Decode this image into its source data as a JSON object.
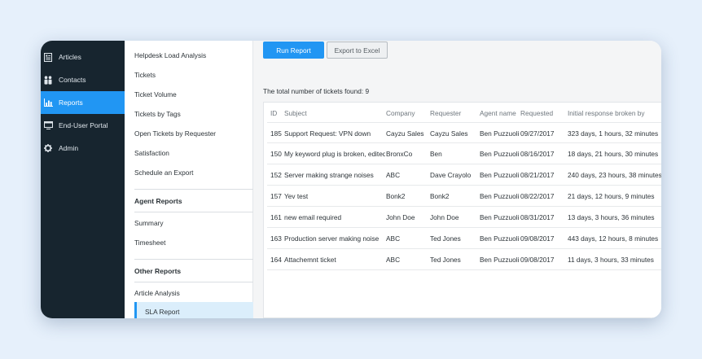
{
  "nav": {
    "items": [
      {
        "label": "Articles",
        "icon": "articles-icon"
      },
      {
        "label": "Contacts",
        "icon": "contacts-icon"
      },
      {
        "label": "Reports",
        "icon": "reports-icon"
      },
      {
        "label": "End-User Portal",
        "icon": "portal-icon"
      },
      {
        "label": "Admin",
        "icon": "gear-icon"
      }
    ],
    "active_index": 2
  },
  "submenu": {
    "items": [
      "Helpdesk Load Analysis",
      "Tickets",
      "Ticket Volume",
      "Tickets by Tags",
      "Open Tickets by Requester",
      "Satisfaction",
      "Schedule an Export"
    ],
    "agent_reports_heading": "Agent Reports",
    "agent_reports": [
      "Summary",
      "Timesheet"
    ],
    "other_reports_heading": "Other Reports",
    "other_reports": [
      "Article Analysis",
      "SLA Report"
    ]
  },
  "toolbar": {
    "run_label": "Run Report",
    "export_label": "Export to Excel"
  },
  "total_text": "The total number of tickets found: 9",
  "table": {
    "headers": [
      "ID",
      "Subject",
      "Company",
      "Requester",
      "Agent name",
      "Requested",
      "Initial response broken by"
    ],
    "rows": [
      {
        "id": "185",
        "subject": "Support Request: VPN down",
        "company": "Cayzu Sales",
        "requester": "Cayzu Sales",
        "agent": "Ben Puzzuoli",
        "requested": "09/27/2017",
        "broken_by": "323 days, 1 hours, 32 minutes"
      },
      {
        "id": "150",
        "subject": "My keyword plug is broken, edited",
        "company": "BronxCo",
        "requester": "Ben",
        "agent": "Ben Puzzuoli",
        "requested": "08/16/2017",
        "broken_by": "18 days, 21 hours, 30 minutes"
      },
      {
        "id": "152",
        "subject": "Server making strange noises",
        "company": "ABC",
        "requester": "Dave Crayolo",
        "agent": "Ben Puzzuoli",
        "requested": "08/21/2017",
        "broken_by": "240 days, 23 hours, 38 minutes"
      },
      {
        "id": "157",
        "subject": "Yev test",
        "company": "Bonk2",
        "requester": "Bonk2",
        "agent": "Ben Puzzuoli",
        "requested": "08/22/2017",
        "broken_by": "21 days, 12 hours, 9 minutes"
      },
      {
        "id": "161",
        "subject": "new email required",
        "company": "John Doe",
        "requester": "John Doe",
        "agent": "Ben Puzzuoli",
        "requested": "08/31/2017",
        "broken_by": "13 days, 3 hours, 36 minutes"
      },
      {
        "id": "163",
        "subject": "Production server making noise",
        "company": "ABC",
        "requester": "Ted Jones",
        "agent": "Ben Puzzuoli",
        "requested": "09/08/2017",
        "broken_by": "443 days, 12 hours, 8 minutes"
      },
      {
        "id": "164",
        "subject": "Attachemnt ticket",
        "company": "ABC",
        "requester": "Ted Jones",
        "agent": "Ben Puzzuoli",
        "requested": "09/08/2017",
        "broken_by": "11 days, 3 hours, 33 minutes"
      }
    ]
  },
  "colors": {
    "accent": "#2196f3",
    "nav_bg": "#17252f",
    "page_bg": "#e6f0fb"
  }
}
